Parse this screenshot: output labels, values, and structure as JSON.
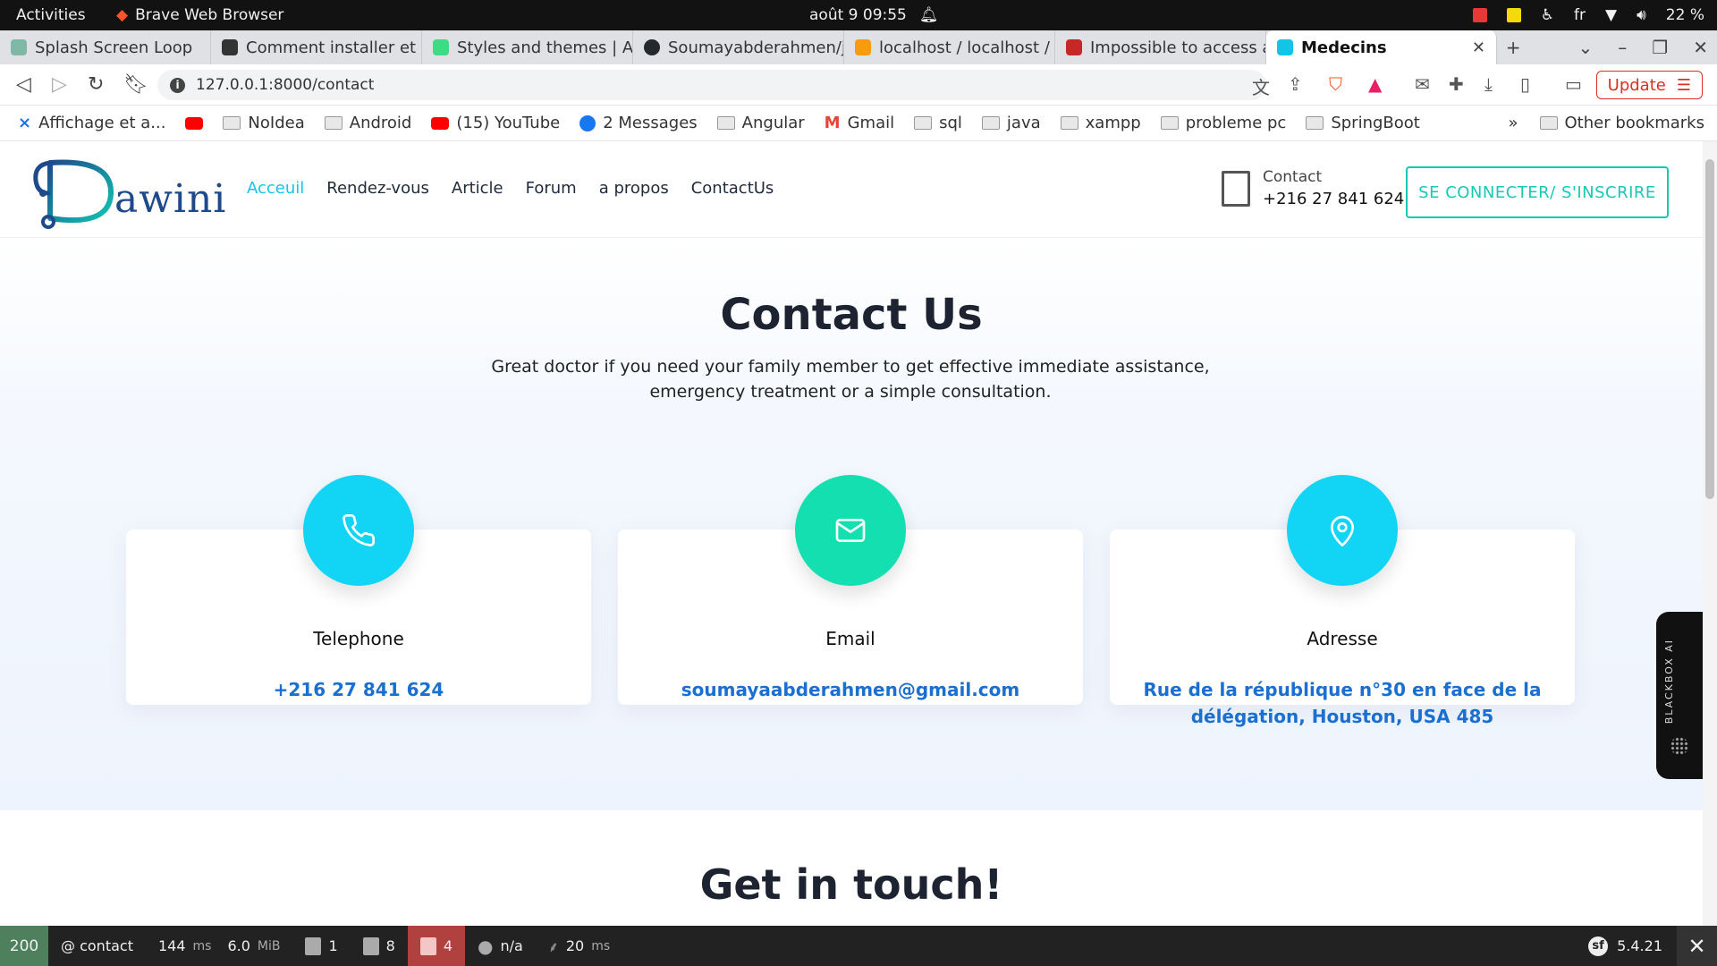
{
  "os_bar": {
    "activities": "Activities",
    "app_name": "Brave Web Browser",
    "clock": "août 9  09:55",
    "language": "fr",
    "battery": "22 %"
  },
  "tabs": [
    {
      "title": "Splash Screen Loop",
      "fav_color": "#7fb8a4"
    },
    {
      "title": "Comment installer et",
      "fav_color": "#333333"
    },
    {
      "title": "Styles and themes  |  A",
      "fav_color": "#3ddc84"
    },
    {
      "title": "Soumayabderahmen/j",
      "fav_color": "#24292e"
    },
    {
      "title": "localhost / localhost /",
      "fav_color": "#f89c0e"
    },
    {
      "title": "Impossible to access a",
      "fav_color": "#c62828"
    },
    {
      "title": "Medecins",
      "fav_color": "#12c5e8",
      "close": "✕"
    }
  ],
  "address_bar": {
    "url": "127.0.0.1:8000/contact",
    "update_label": "Update"
  },
  "bookmarks": [
    {
      "label": "Affichage et a...",
      "icon": "x-icon"
    },
    {
      "label": "",
      "icon": "youtube-icon"
    },
    {
      "label": "NoIdea",
      "icon": "folder-icon"
    },
    {
      "label": "Android",
      "icon": "folder-icon"
    },
    {
      "label": "(15) YouTube",
      "icon": "youtube-icon"
    },
    {
      "label": "2 Messages",
      "icon": "facebook-icon"
    },
    {
      "label": "Angular",
      "icon": "folder-icon"
    },
    {
      "label": "Gmail",
      "icon": "gmail-icon"
    },
    {
      "label": "sql",
      "icon": "folder-icon"
    },
    {
      "label": "java",
      "icon": "folder-icon"
    },
    {
      "label": "xampp",
      "icon": "folder-icon"
    },
    {
      "label": "probleme pc",
      "icon": "folder-icon"
    },
    {
      "label": "SpringBoot",
      "icon": "folder-icon"
    }
  ],
  "bookmarks_overflow": "»",
  "other_bookmarks": "Other bookmarks",
  "site": {
    "logo_text": "awini",
    "nav": [
      "Acceuil",
      "Rendez-vous",
      "Article",
      "Forum",
      "a propos",
      "ContactUs"
    ],
    "contact_label": "Contact",
    "contact_number": "+216 27 841 624",
    "login_button": "SE CONNECTER/ S'INSCRIRE"
  },
  "hero": {
    "title": "Contact Us",
    "subtitle": "Great doctor if you need your family member to get effective immediate assistance, emergency treatment or a simple consultation."
  },
  "cards": [
    {
      "title": "Telephone",
      "value": "+216 27 841 624",
      "icon": "phone-icon",
      "color": "#12d4f5"
    },
    {
      "title": "Email",
      "value": "soumayaabderahmen@gmail.com",
      "icon": "mail-icon",
      "color": "#13dfb0"
    },
    {
      "title": "Adresse",
      "value": "Rue de la république n°30 en face de la délégation, Houston, USA 485",
      "icon": "location-pin-icon",
      "color": "#12d4f5"
    }
  ],
  "section2_title": "Get in touch!",
  "blackbox_label": "BLACKBOX AI",
  "profiler": {
    "status": "200",
    "route": "@ contact",
    "time": "144",
    "time_unit": "ms",
    "memory": "6.0",
    "memory_unit": "MiB",
    "forms": "1",
    "logs": "8",
    "translations": "4",
    "user": "n/a",
    "twig_time": "20",
    "twig_unit": "ms",
    "version": "5.4.21"
  },
  "colors": {
    "accent_cyan": "#12c5e8",
    "accent_teal": "#16c9b3",
    "link_blue": "#1a6fd1",
    "update_red": "#d93025"
  }
}
